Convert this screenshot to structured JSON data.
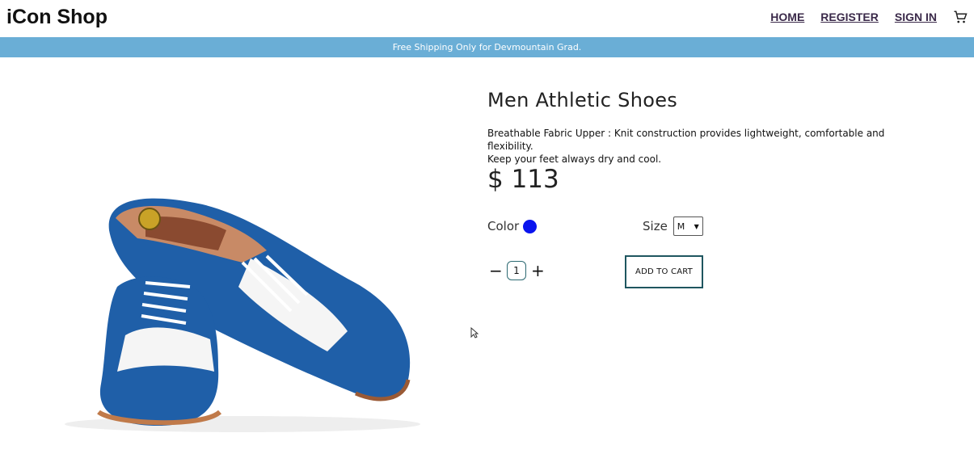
{
  "header": {
    "logo": "iCon Shop",
    "nav": [
      "HOME",
      "REGISTER",
      "SIGN IN"
    ],
    "cart_icon": "cart-icon"
  },
  "banner": {
    "text": "Free Shipping Only for Devmountain Grad."
  },
  "product": {
    "title": "Men Athletic Shoes",
    "description_line1": "Breathable Fabric Upper : Knit construction provides lightweight, comfortable and flexibility.",
    "description_line2": "Keep your feet always dry and cool.",
    "price": "$ 113",
    "color_label": "Color",
    "color_value": "#0a14ee",
    "size_label": "Size",
    "size_selected": "M",
    "quantity": "1",
    "minus_label": "−",
    "plus_label": "+",
    "add_to_cart_label": "ADD TO CART",
    "image_icon": "blue-white-wingtip-shoes-image"
  },
  "colors": {
    "banner": "#6aaed6",
    "nav_link": "#3b2a4a",
    "accent_border": "#1f5660",
    "shoe_blue": "#1f5fa8"
  }
}
